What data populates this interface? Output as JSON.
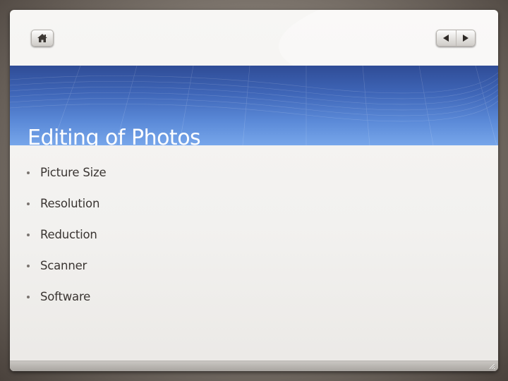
{
  "slide": {
    "title": "Editing of Photos",
    "bullets": [
      "Picture Size",
      "Resolution",
      "Reduction",
      "Scanner",
      "Software"
    ]
  },
  "navigation": {
    "home_icon": "home-icon",
    "prev_icon": "triangle-left-icon",
    "next_icon": "triangle-right-icon"
  },
  "colors": {
    "banner_top": "#2f4c96",
    "banner_bottom": "#77a6ea",
    "title_text": "#ffffff",
    "body_text": "#3a3532"
  }
}
